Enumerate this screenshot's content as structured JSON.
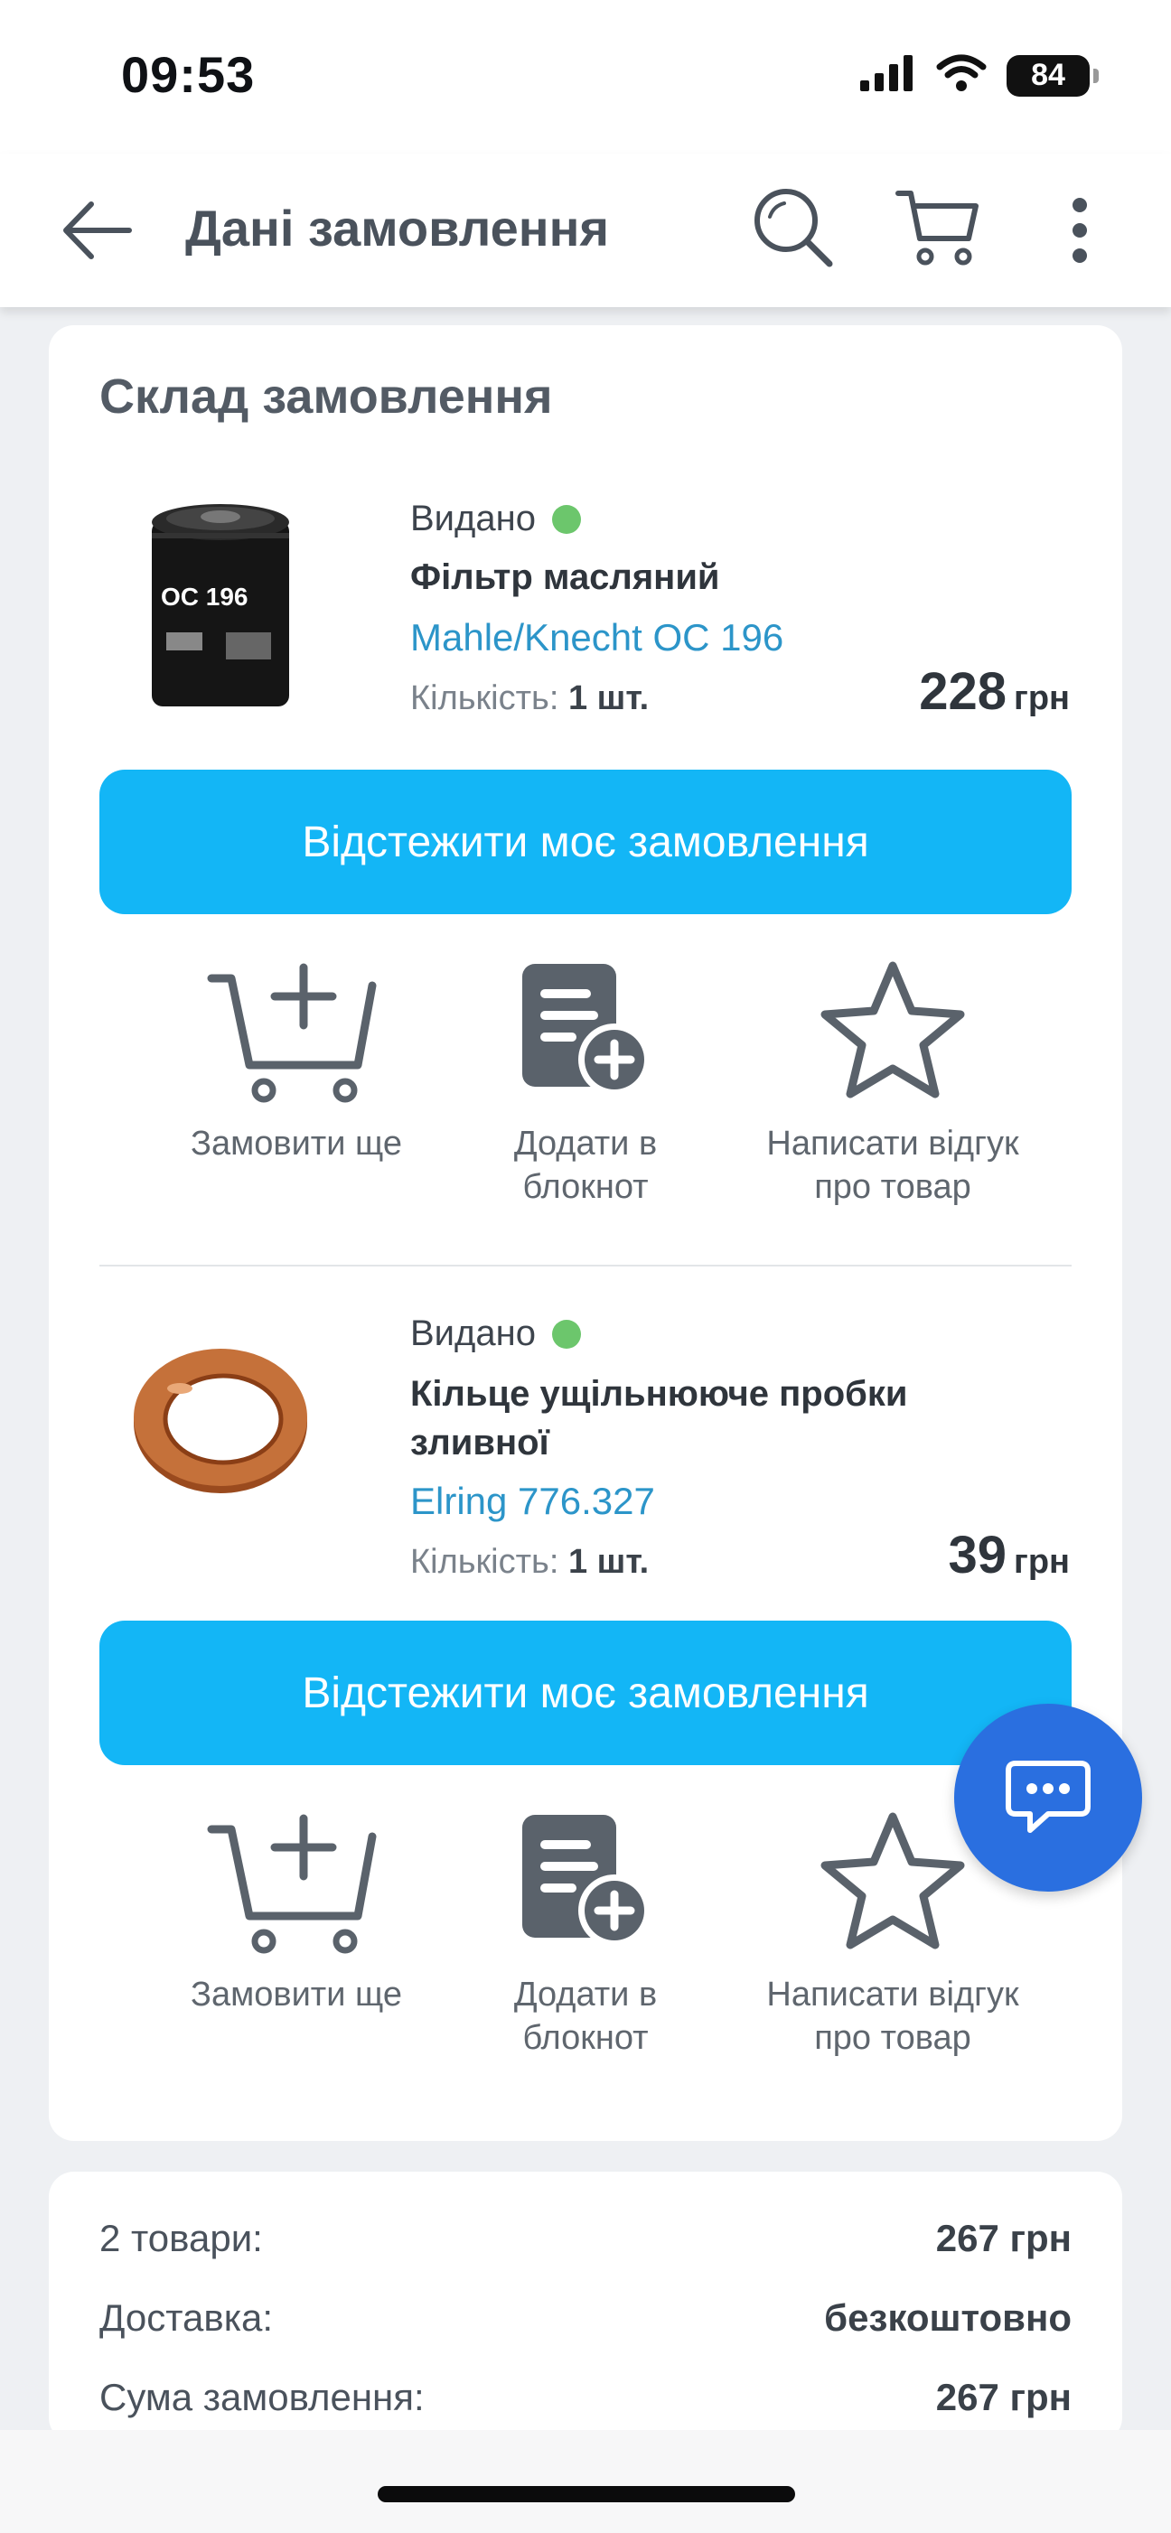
{
  "status_bar": {
    "time": "09:53",
    "battery": "84"
  },
  "header": {
    "title": "Дані замовлення"
  },
  "order": {
    "title": "Склад замовлення",
    "items": [
      {
        "status": "Видано",
        "status_color": "#6cc66c",
        "name": "Фільтр масляний",
        "brand": "Mahle/Knecht OC 196",
        "qty_label": "Кількість:",
        "qty_value": "1 шт.",
        "price": "228",
        "currency": "грн",
        "track_label": "Відстежити моє замовлення",
        "actions": {
          "reorder": "Замовити ще",
          "notebook_line1": "Додати в",
          "notebook_line2": "блокнот",
          "review_line1": "Написати відгук",
          "review_line2": "про товар"
        }
      },
      {
        "status": "Видано",
        "status_color": "#6cc66c",
        "name": "Кільце ущільнююче пробки зливної",
        "brand": "Elring 776.327",
        "qty_label": "Кількість:",
        "qty_value": "1 шт.",
        "price": "39",
        "currency": "грн",
        "track_label": "Відстежити моє замовлення",
        "actions": {
          "reorder": "Замовити ще",
          "notebook_line1": "Додати в",
          "notebook_line2": "блокнот",
          "review_line1": "Написати відгук",
          "review_line2": "про товар"
        }
      }
    ]
  },
  "summary": {
    "items_label": "2 товари:",
    "items_value": "267 грн",
    "delivery_label": "Доставка:",
    "delivery_value": "безкоштовно",
    "total_label": "Сума замовлення:",
    "total_value": "267 грн"
  },
  "colors": {
    "accent": "#13b6f6",
    "chat": "#2a6fe0",
    "brand_link": "#2c95c9"
  }
}
